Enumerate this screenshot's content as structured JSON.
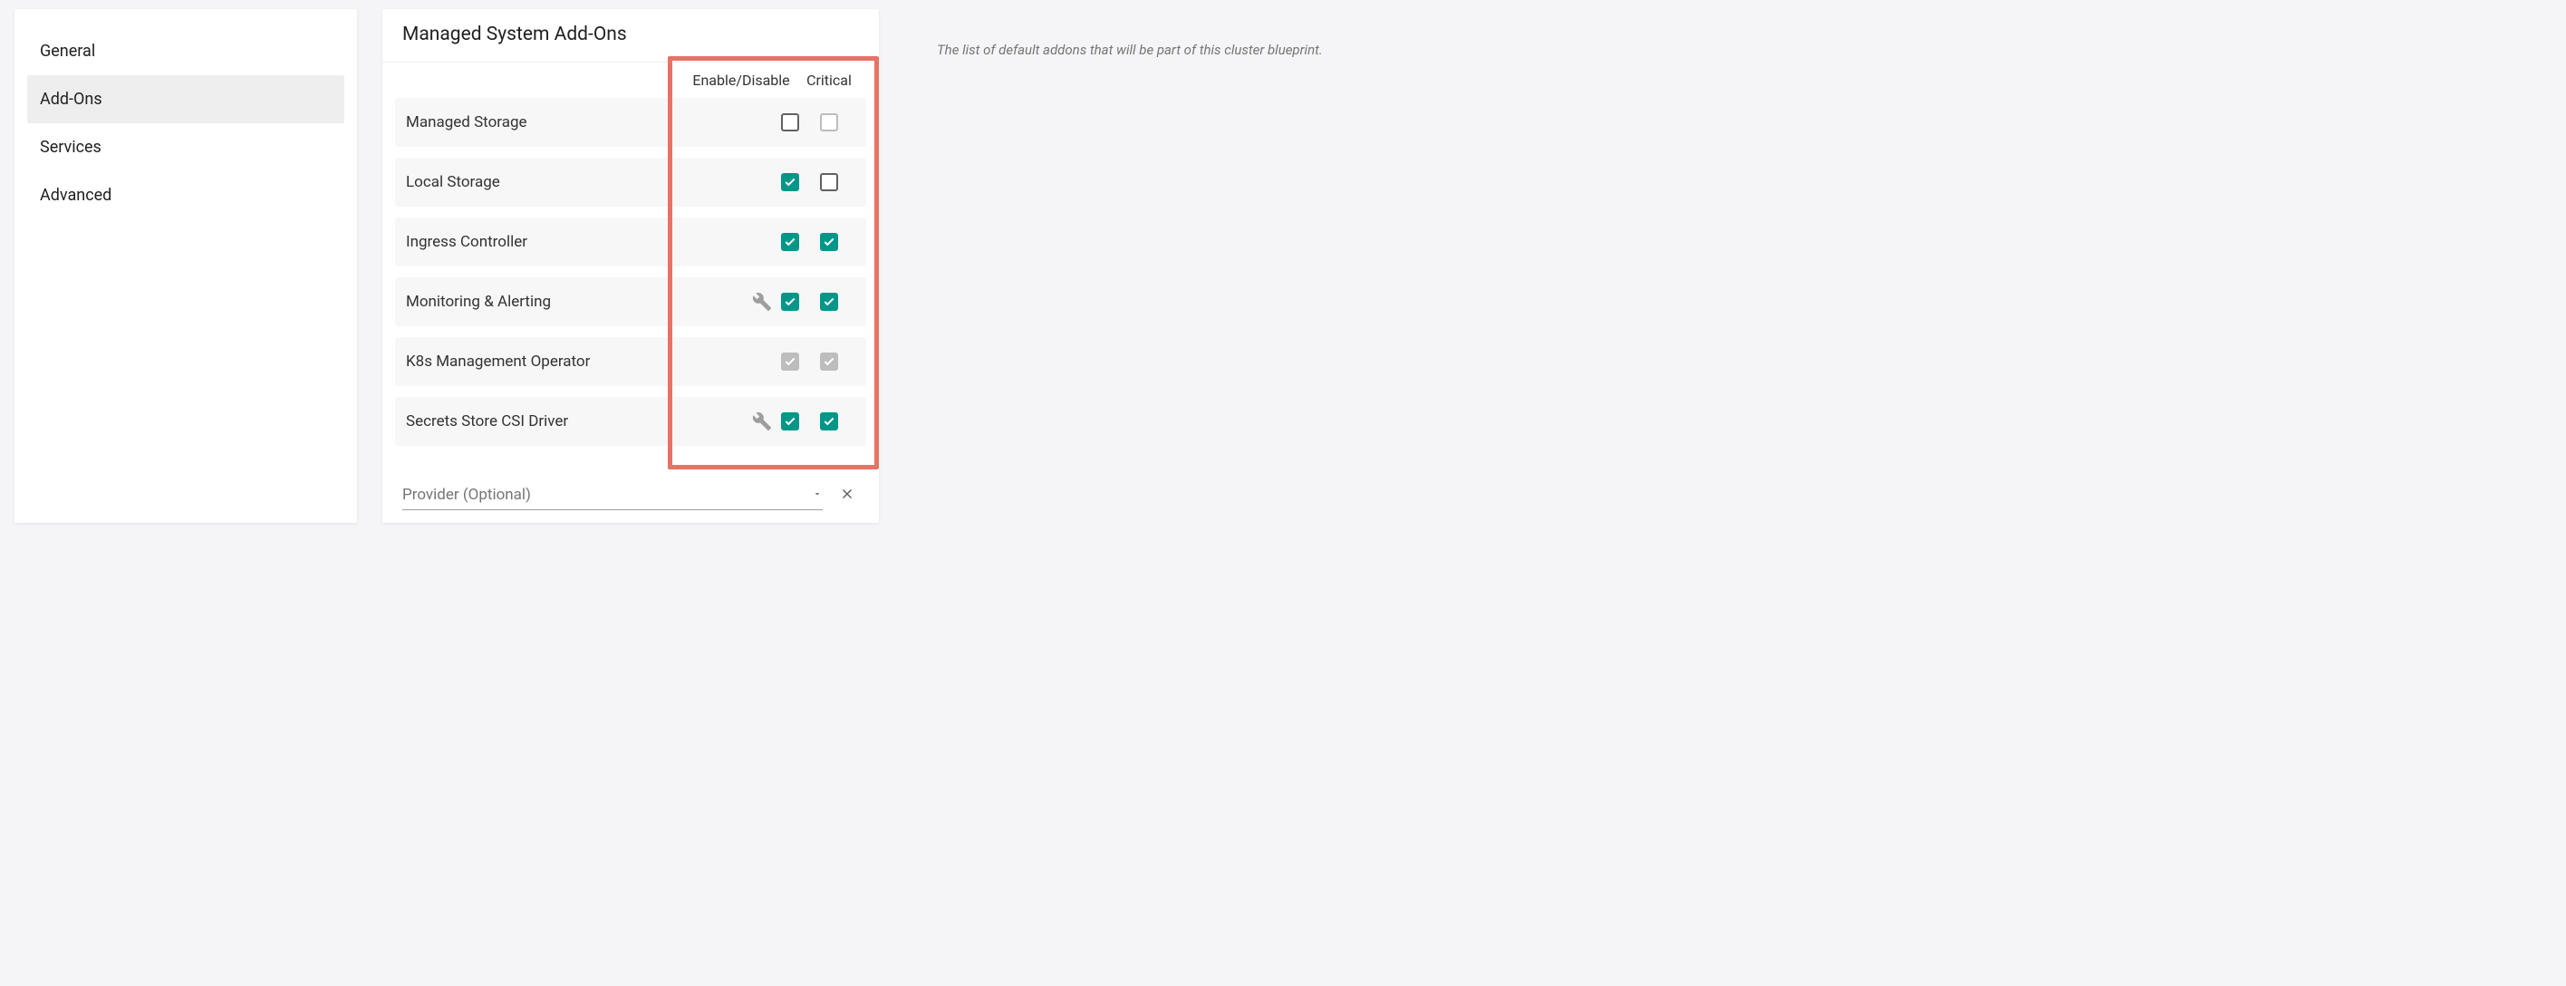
{
  "sidebar": {
    "items": [
      {
        "label": "General"
      },
      {
        "label": "Add-Ons"
      },
      {
        "label": "Services"
      },
      {
        "label": "Advanced"
      }
    ],
    "activeIndex": 1
  },
  "panel": {
    "title": "Managed System Add-Ons",
    "columns": {
      "enable": "Enable/Disable",
      "critical": "Critical"
    },
    "addons": [
      {
        "label": "Managed Storage",
        "hasWrench": false,
        "enabled": false,
        "critical": false,
        "enabledDisabled": false,
        "criticalDisabled": true
      },
      {
        "label": "Local Storage",
        "hasWrench": false,
        "enabled": true,
        "critical": false,
        "enabledDisabled": false,
        "criticalDisabled": false
      },
      {
        "label": "Ingress Controller",
        "hasWrench": false,
        "enabled": true,
        "critical": true,
        "enabledDisabled": false,
        "criticalDisabled": false
      },
      {
        "label": "Monitoring & Alerting",
        "hasWrench": true,
        "enabled": true,
        "critical": true,
        "enabledDisabled": false,
        "criticalDisabled": false
      },
      {
        "label": "K8s Management Operator",
        "hasWrench": false,
        "enabled": true,
        "critical": true,
        "enabledDisabled": true,
        "criticalDisabled": true
      },
      {
        "label": "Secrets Store CSI Driver",
        "hasWrench": true,
        "enabled": true,
        "critical": true,
        "enabledDisabled": false,
        "criticalDisabled": false
      }
    ],
    "provider": {
      "label": "Provider (Optional)",
      "value": ""
    }
  },
  "helper": "The list of default addons that will be part of this cluster blueprint."
}
